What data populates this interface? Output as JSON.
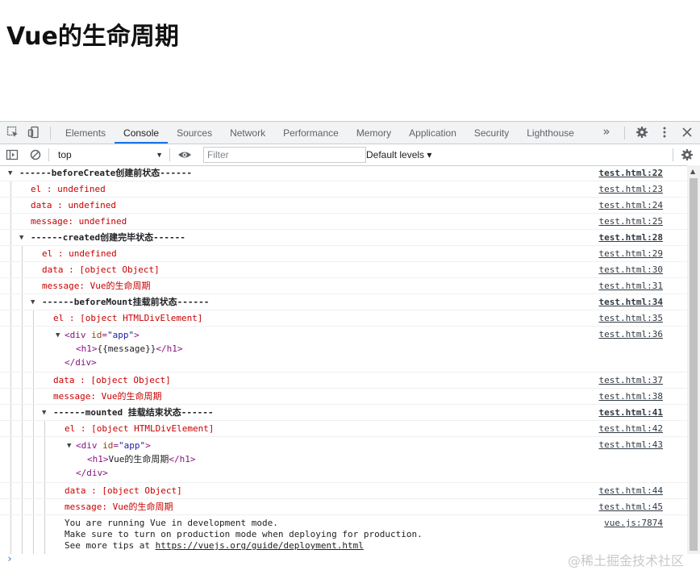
{
  "page": {
    "heading": "Vue的生命周期"
  },
  "devtools": {
    "tabs": [
      "Elements",
      "Console",
      "Sources",
      "Network",
      "Performance",
      "Memory",
      "Application",
      "Security",
      "Lighthouse"
    ],
    "active_tab": "Console",
    "more_tabs": "»",
    "context": "top",
    "filter_placeholder": "Filter",
    "levels": "Default levels ▾"
  },
  "console": {
    "g1": {
      "title": "------beforeCreate创建前状态------",
      "src": "test.html:22"
    },
    "g1_rows": [
      {
        "text": "el     : undefined",
        "src": "test.html:23"
      },
      {
        "text": "data   : undefined",
        "src": "test.html:24"
      },
      {
        "text": "message: undefined",
        "src": "test.html:25"
      }
    ],
    "g2": {
      "title": "------created创建完毕状态------",
      "src": "test.html:28"
    },
    "g2_rows": [
      {
        "text": "el     : undefined",
        "src": "test.html:29"
      },
      {
        "text": "data   : [object Object]",
        "src": "test.html:30"
      },
      {
        "text": "message: Vue的生命周期",
        "src": "test.html:31"
      }
    ],
    "g3": {
      "title": "------beforeMount挂载前状态------",
      "src": "test.html:34"
    },
    "g3_el": {
      "text": "el     : [object HTMLDivElement]",
      "src": "test.html:35"
    },
    "g3_dom": {
      "src": "test.html:36",
      "open_tag": "div",
      "attr": "id",
      "attr_val": "\"app\"",
      "inner_tag": "h1",
      "inner_text": "{{message}}",
      "close_inner": "</h1>",
      "close_outer": "</div>",
      "open_inner": "<h1>"
    },
    "g3_rows": [
      {
        "text": "data   : [object Object]",
        "src": "test.html:37"
      },
      {
        "text": "message: Vue的生命周期",
        "src": "test.html:38"
      }
    ],
    "g4": {
      "title": "------mounted 挂载结束状态------",
      "src": "test.html:41"
    },
    "g4_el": {
      "text": "el     : [object HTMLDivElement]",
      "src": "test.html:42"
    },
    "g4_dom": {
      "src": "test.html:43",
      "open_tag": "div",
      "attr": "id",
      "attr_val": "\"app\"",
      "inner_text": "Vue的生命周期",
      "close_inner": "</h1>",
      "close_outer": "</div>",
      "open_inner": "<h1>"
    },
    "g4_rows": [
      {
        "text": "data   : [object Object]",
        "src": "test.html:44"
      },
      {
        "text": "message: Vue的生命周期",
        "src": "test.html:45"
      }
    ],
    "vue": {
      "line1": "You are running Vue in development mode.",
      "line2": "Make sure to turn on production mode when deploying for production.",
      "line3_prefix": "See more tips at ",
      "line3_link": "https://vuejs.org/guide/deployment.html",
      "src": "vue.js:7874"
    }
  },
  "watermark": "@稀土掘金技术社区",
  "prompt_symbol": "›"
}
